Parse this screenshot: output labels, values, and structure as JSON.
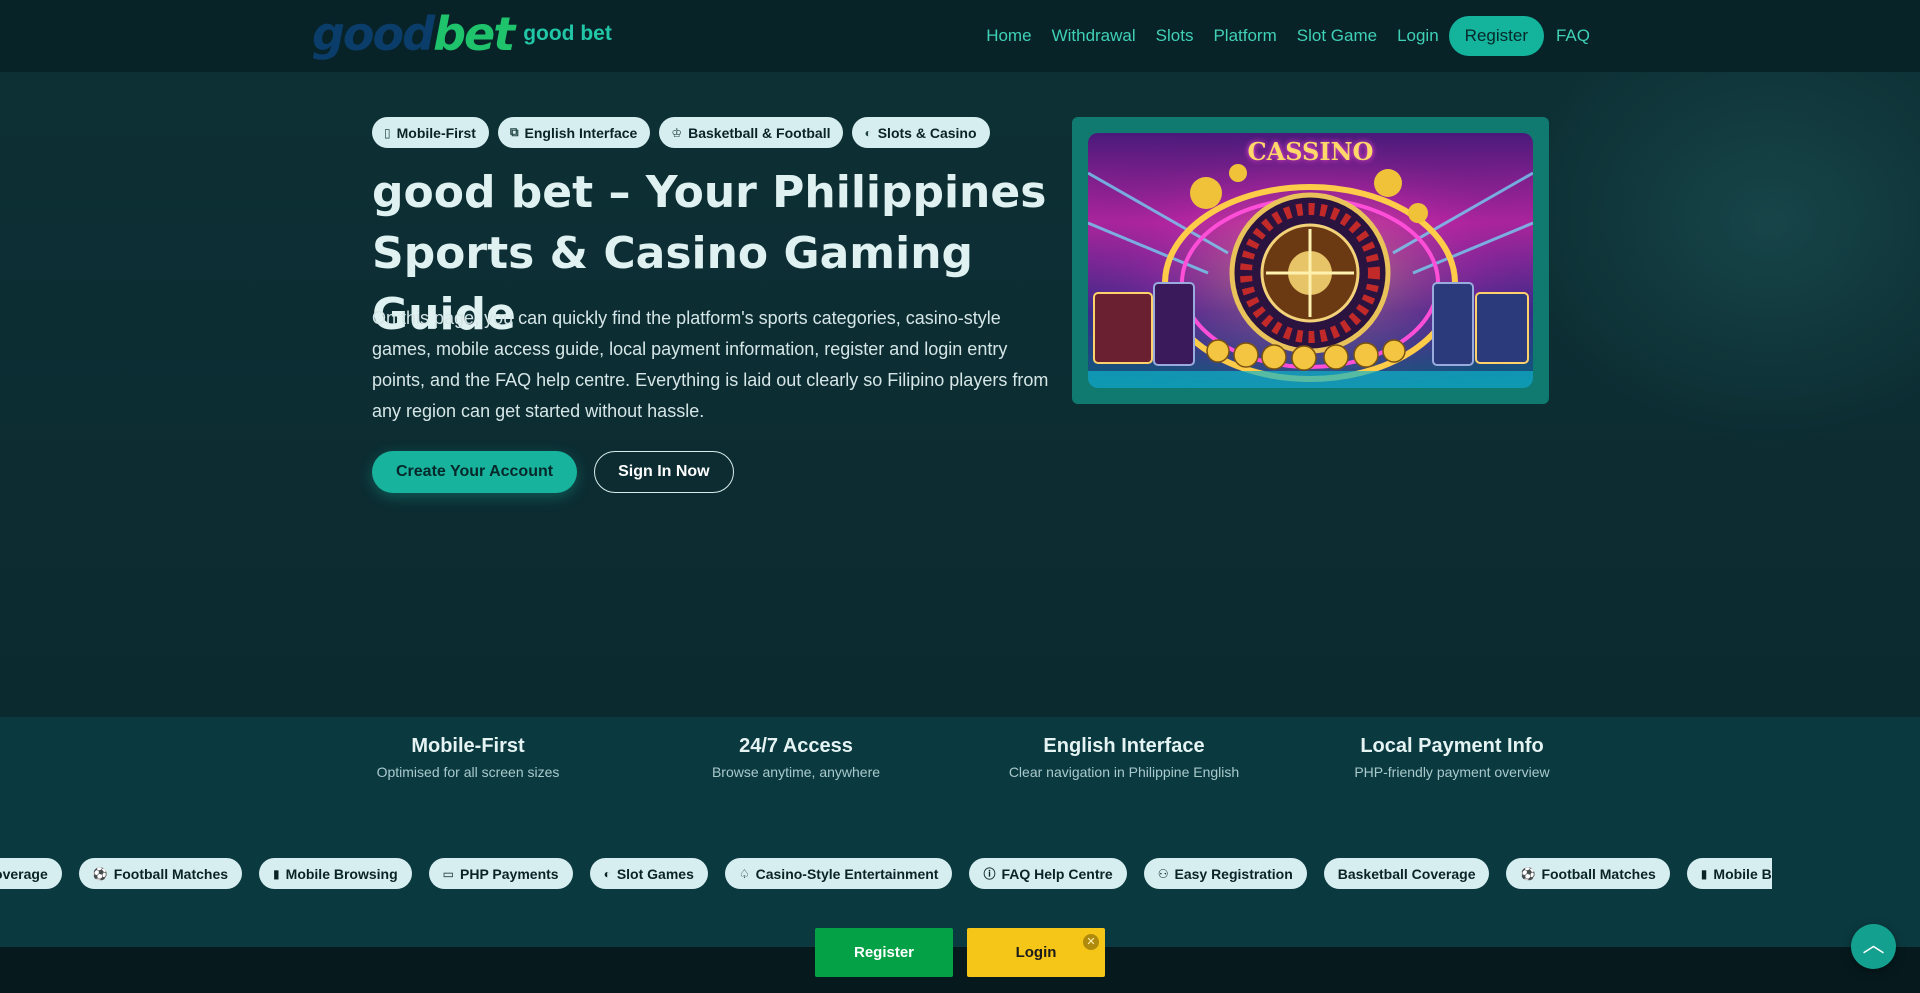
{
  "header": {
    "logo_part1": "good",
    "logo_part2": "bet",
    "brand": "good bet",
    "nav": [
      "Home",
      "Withdrawal",
      "Slots",
      "Platform",
      "Slot Game",
      "Login"
    ],
    "register": "Register",
    "faq": "FAQ"
  },
  "hero": {
    "chips": [
      {
        "icon": "mobile-icon",
        "label": "Mobile-First"
      },
      {
        "icon": "translate-icon",
        "label": "English Interface"
      },
      {
        "icon": "trophy-icon",
        "label": "Basketball & Football"
      },
      {
        "icon": "gamepad-icon",
        "label": "Slots & Casino"
      }
    ],
    "title": "good bet – Your Philippines Sports & Casino Gaming Guide",
    "description": "On this page, you can quickly find the platform's sports categories, casino-style games, mobile access guide, local payment information, register and login entry points, and the FAQ help centre. Everything is laid out clearly so Filipino players from any region can get started without hassle.",
    "primary_button": "Create Your Account",
    "secondary_button": "Sign In Now",
    "image_text": "CASSINO"
  },
  "stats": [
    {
      "title": "Mobile-First",
      "subtitle": "Optimised for all screen sizes"
    },
    {
      "title": "24/7 Access",
      "subtitle": "Browse anytime, anywhere"
    },
    {
      "title": "English Interface",
      "subtitle": "Clear navigation in Philippine English"
    },
    {
      "title": "Local Payment Info",
      "subtitle": "PHP-friendly payment overview"
    }
  ],
  "ticker": [
    {
      "icon": "",
      "label": "Basketball Coverage"
    },
    {
      "icon": "football-icon",
      "label": "Football Matches"
    },
    {
      "icon": "phone-icon",
      "label": "Mobile Browsing"
    },
    {
      "icon": "card-icon",
      "label": "PHP Payments"
    },
    {
      "icon": "gamepad-icon",
      "label": "Slot Games"
    },
    {
      "icon": "spade-icon",
      "label": "Casino-Style Entertainment"
    },
    {
      "icon": "help-icon",
      "label": "FAQ Help Centre"
    },
    {
      "icon": "user-plus-icon",
      "label": "Easy Registration"
    },
    {
      "icon": "",
      "label": "Basketball Coverage"
    },
    {
      "icon": "football-icon",
      "label": "Football Matches"
    },
    {
      "icon": "phone-icon",
      "label": "Mobile Browsing"
    }
  ],
  "sticky": {
    "register": "Register",
    "login": "Login",
    "close": "✕"
  },
  "back_to_top": "︿",
  "colors": {
    "accent": "#17b39d",
    "register_green": "#05a146",
    "login_yellow": "#f5c518"
  }
}
